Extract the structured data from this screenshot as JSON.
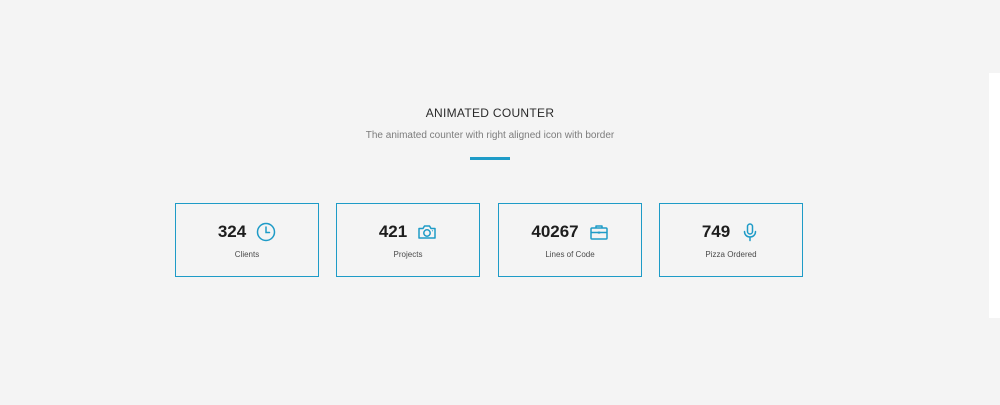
{
  "section": {
    "title": "ANIMATED COUNTER",
    "subtitle": "The animated counter with right aligned icon with border",
    "accent_color": "#1e9bc7"
  },
  "counters": [
    {
      "value": "324",
      "label": "Clients",
      "icon": "clock-icon"
    },
    {
      "value": "421",
      "label": "Projects",
      "icon": "camera-icon"
    },
    {
      "value": "40267",
      "label": "Lines of Code",
      "icon": "briefcase-icon"
    },
    {
      "value": "749",
      "label": "Pizza Ordered",
      "icon": "microphone-icon"
    }
  ]
}
